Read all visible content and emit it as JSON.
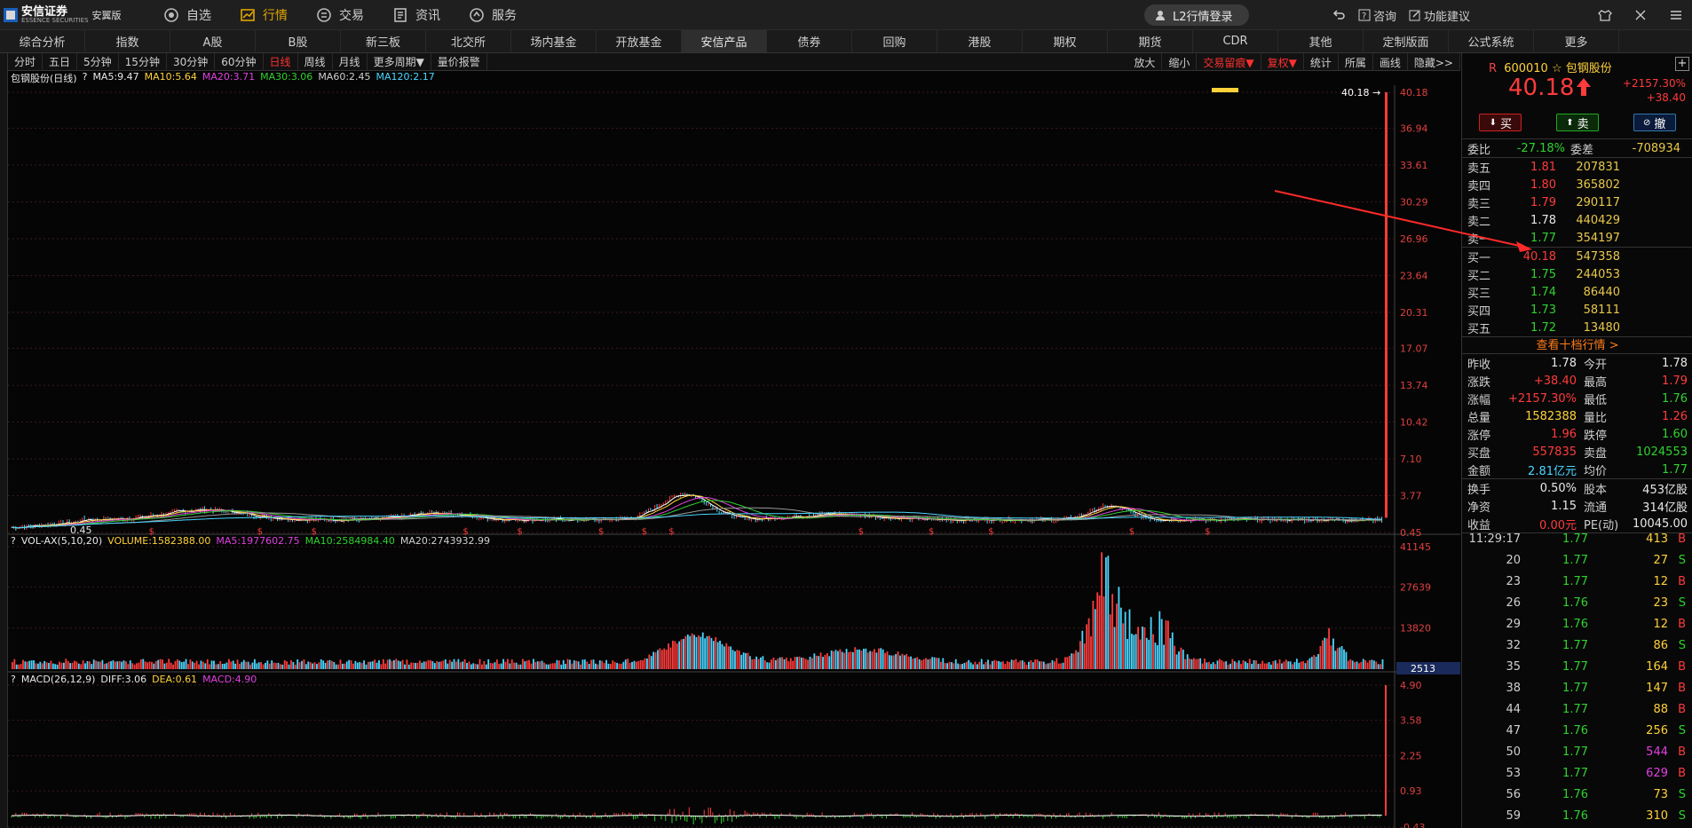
{
  "app": {
    "logo_name": "安信证券",
    "logo_sub": "ESSENCE SECURITIES",
    "edition": "安翼版"
  },
  "nav": [
    {
      "label": "自选"
    },
    {
      "label": "行情",
      "active": true
    },
    {
      "label": "交易"
    },
    {
      "label": "资讯"
    },
    {
      "label": "服务"
    }
  ],
  "l2_login": "L2行情登录",
  "tools": {
    "consult": "咨询",
    "feedback": "功能建议"
  },
  "cattabs": [
    "综合分析",
    "指数",
    "A股",
    "B股",
    "新三板",
    "北交所",
    "场内基金",
    "开放基金",
    "安信产品",
    "债券",
    "回购",
    "港股",
    "期权",
    "期货",
    "CDR",
    "其他",
    "定制版面",
    "公式系统",
    "更多"
  ],
  "active_cattab": "安信产品",
  "periods": [
    "分时",
    "五日",
    "5分钟",
    "15分钟",
    "30分钟",
    "60分钟",
    "日线",
    "周线",
    "月线",
    "更多周期▼",
    "量价报警"
  ],
  "active_period": "日线",
  "right_tools": [
    "放大",
    "缩小",
    "交易留痕▼",
    "复权▼",
    "统计",
    "所属",
    "画线",
    "隐藏>>"
  ],
  "ma_line": {
    "name": "包钢股份(日线)",
    "q": "?",
    "ma5": "MA5:9.47",
    "ma10": "MA10:5.64",
    "ma20": "MA20:3.71",
    "ma30": "MA30:3.06",
    "ma60": "MA60:2.45",
    "ma120": "MA120:2.17"
  },
  "vol_line": {
    "q": "?",
    "name": "VOL-AX(5,10,20)",
    "volume": "VOLUME:1582388.00",
    "ma5": "MA5:1977602.75",
    "ma10": "MA10:2584984.40",
    "ma20": "MA20:2743932.99"
  },
  "macd_line": {
    "q": "?",
    "name": "MACD(26,12,9)",
    "diff": "DIFF:3.06",
    "dea": "DEA:0.61",
    "macd": "MACD:4.90"
  },
  "chart_data": [
    {
      "type": "candlestick",
      "title": "包钢股份(日线)",
      "ylim": [
        0.45,
        40.18
      ],
      "y_ticks": [
        40.18,
        36.94,
        33.61,
        30.29,
        26.96,
        23.64,
        20.31,
        17.07,
        13.74,
        10.42,
        7.1,
        3.77,
        0.45
      ],
      "last_price": 40.18,
      "min_label": "0.45",
      "series": [
        {
          "name": "MA5",
          "value": 9.47,
          "color": "#ffffff"
        },
        {
          "name": "MA10",
          "value": 5.64,
          "color": "#ffd23a"
        },
        {
          "name": "MA20",
          "value": 3.71,
          "color": "#e040e0"
        },
        {
          "name": "MA30",
          "value": 3.06,
          "color": "#2fd22f"
        },
        {
          "name": "MA60",
          "value": 2.45,
          "color": "#cfcfcf"
        },
        {
          "name": "MA120",
          "value": 2.17,
          "color": "#4ad6ff"
        }
      ]
    },
    {
      "type": "bar",
      "title": "VOL-AX(5,10,20)",
      "y_ticks": [
        41145,
        27639,
        13820
      ],
      "last_value": "2513"
    },
    {
      "type": "bar",
      "title": "MACD(26,12,9)",
      "y_ticks": [
        4.9,
        3.58,
        2.25,
        0.93,
        -0.43
      ]
    }
  ],
  "quote": {
    "r": "R",
    "code": "600010",
    "star": "☆",
    "name": "包钢股份",
    "price": "40.18",
    "change_pct": "+2157.30%",
    "change": "+38.40",
    "buy": "买",
    "sell": "卖",
    "cancel": "撤",
    "weibi_label": "委比",
    "weibi": "-27.18%",
    "weicha_label": "委差",
    "weicha": "-708934",
    "asks": [
      {
        "l": "卖五",
        "p": "1.81",
        "v": "207831",
        "c": "red"
      },
      {
        "l": "卖四",
        "p": "1.80",
        "v": "365802",
        "c": "red"
      },
      {
        "l": "卖三",
        "p": "1.79",
        "v": "290117",
        "c": "red"
      },
      {
        "l": "卖二",
        "p": "1.78",
        "v": "440429",
        "c": "white"
      },
      {
        "l": "卖一",
        "p": "1.77",
        "v": "354197",
        "c": "green"
      }
    ],
    "bids": [
      {
        "l": "买一",
        "p": "40.18",
        "v": "547358",
        "c": "red"
      },
      {
        "l": "买二",
        "p": "1.75",
        "v": "244053",
        "c": "green"
      },
      {
        "l": "买三",
        "p": "1.74",
        "v": "86440",
        "c": "green"
      },
      {
        "l": "买四",
        "p": "1.73",
        "v": "58111",
        "c": "green"
      },
      {
        "l": "买五",
        "p": "1.72",
        "v": "13480",
        "c": "green"
      }
    ],
    "ten_link": "查看十档行情 >",
    "stats": [
      [
        {
          "k": "昨收",
          "v": "1.78",
          "c": "white"
        },
        {
          "k": "今开",
          "v": "1.78",
          "c": "white"
        }
      ],
      [
        {
          "k": "涨跌",
          "v": "+38.40",
          "c": "red"
        },
        {
          "k": "最高",
          "v": "1.79",
          "c": "red"
        }
      ],
      [
        {
          "k": "涨幅",
          "v": "+2157.30%",
          "c": "red"
        },
        {
          "k": "最低",
          "v": "1.76",
          "c": "green"
        }
      ],
      [
        {
          "k": "总量",
          "v": "1582388",
          "c": "yellow"
        },
        {
          "k": "量比",
          "v": "1.26",
          "c": "red"
        }
      ],
      [
        {
          "k": "涨停",
          "v": "1.96",
          "c": "red"
        },
        {
          "k": "跌停",
          "v": "1.60",
          "c": "green"
        }
      ],
      [
        {
          "k": "买盘",
          "v": "557835",
          "c": "red"
        },
        {
          "k": "卖盘",
          "v": "1024553",
          "c": "green"
        }
      ],
      [
        {
          "k": "金额",
          "v": "2.81亿元",
          "c": "cyan"
        },
        {
          "k": "均价",
          "v": "1.77",
          "c": "green"
        }
      ]
    ],
    "stats2": [
      [
        {
          "k": "换手",
          "v": "0.50%",
          "c": "white"
        },
        {
          "k": "股本",
          "v": "453亿股",
          "c": "white"
        }
      ],
      [
        {
          "k": "净资",
          "v": "1.15",
          "c": "white"
        },
        {
          "k": "流通",
          "v": "314亿股",
          "c": "white"
        }
      ],
      [
        {
          "k": "收益",
          "v": "0.00元",
          "c": "red"
        },
        {
          "k": "PE(动)",
          "v": "10045.00",
          "c": "white"
        }
      ]
    ],
    "ticks": [
      {
        "t": "11:29:17",
        "p": "1.77",
        "v": "413",
        "d": "B",
        "pc": "green",
        "vc": "yellow",
        "dc": "red"
      },
      {
        "t": "20",
        "p": "1.77",
        "v": "27",
        "d": "S",
        "pc": "green",
        "vc": "yellow",
        "dc": "green"
      },
      {
        "t": "23",
        "p": "1.77",
        "v": "12",
        "d": "B",
        "pc": "green",
        "vc": "yellow",
        "dc": "red"
      },
      {
        "t": "26",
        "p": "1.76",
        "v": "23",
        "d": "S",
        "pc": "green",
        "vc": "yellow",
        "dc": "green"
      },
      {
        "t": "29",
        "p": "1.76",
        "v": "12",
        "d": "B",
        "pc": "green",
        "vc": "yellow",
        "dc": "red"
      },
      {
        "t": "32",
        "p": "1.77",
        "v": "86",
        "d": "S",
        "pc": "green",
        "vc": "yellow",
        "dc": "green"
      },
      {
        "t": "35",
        "p": "1.77",
        "v": "164",
        "d": "B",
        "pc": "green",
        "vc": "yellow",
        "dc": "red"
      },
      {
        "t": "38",
        "p": "1.77",
        "v": "147",
        "d": "B",
        "pc": "green",
        "vc": "yellow",
        "dc": "red"
      },
      {
        "t": "44",
        "p": "1.77",
        "v": "88",
        "d": "B",
        "pc": "green",
        "vc": "yellow",
        "dc": "red"
      },
      {
        "t": "47",
        "p": "1.76",
        "v": "256",
        "d": "S",
        "pc": "green",
        "vc": "yellow",
        "dc": "green"
      },
      {
        "t": "50",
        "p": "1.77",
        "v": "544",
        "d": "B",
        "pc": "green",
        "vc": "purple",
        "dc": "red"
      },
      {
        "t": "53",
        "p": "1.77",
        "v": "629",
        "d": "B",
        "pc": "green",
        "vc": "purple",
        "dc": "red"
      },
      {
        "t": "56",
        "p": "1.76",
        "v": "73",
        "d": "S",
        "pc": "green",
        "vc": "yellow",
        "dc": "green"
      },
      {
        "t": "59",
        "p": "1.76",
        "v": "310",
        "d": "S",
        "pc": "green",
        "vc": "yellow",
        "dc": "green"
      }
    ]
  },
  "colors": {
    "up": "#ff3b3b",
    "down": "#2fd22f",
    "accent": "#e0a500",
    "bg": "#050505"
  }
}
